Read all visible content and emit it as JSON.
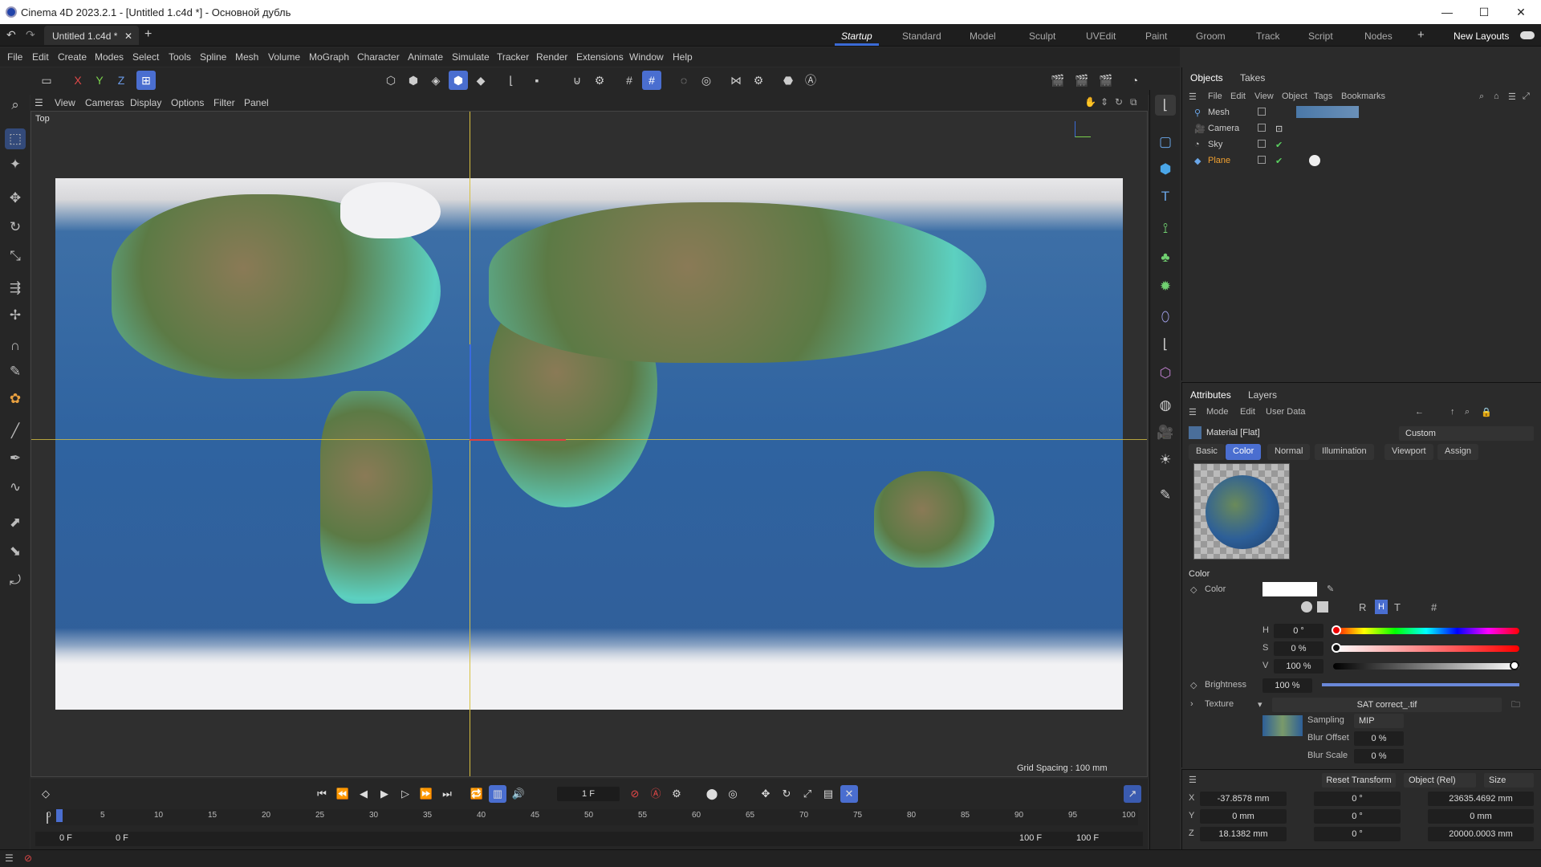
{
  "window": {
    "title": "Cinema 4D 2023.2.1 - [Untitled 1.c4d *] - Основной дубль"
  },
  "tabs": {
    "document": "Untitled 1.c4d *",
    "layouts": [
      "Startup",
      "Standard",
      "Model",
      "Sculpt",
      "UVEdit",
      "Paint",
      "Groom",
      "Track",
      "Script",
      "Nodes"
    ],
    "new_layouts": "New Layouts"
  },
  "menu": [
    "File",
    "Edit",
    "Create",
    "Modes",
    "Select",
    "Tools",
    "Spline",
    "Mesh",
    "Volume",
    "MoGraph",
    "Character",
    "Animate",
    "Simulate",
    "Tracker",
    "Render",
    "Extensions",
    "Window",
    "Help"
  ],
  "axis": {
    "x": "X",
    "y": "Y",
    "z": "Z"
  },
  "viewport": {
    "menu": [
      "View",
      "Cameras",
      "Display",
      "Options",
      "Filter",
      "Panel"
    ],
    "label": "Top",
    "grid_spacing": "Grid Spacing : 100 mm"
  },
  "objects": {
    "tabs": [
      "Objects",
      "Takes"
    ],
    "menu": [
      "File",
      "Edit",
      "View",
      "Object",
      "Tags",
      "Bookmarks"
    ],
    "items": [
      {
        "name": "Mesh",
        "color": "#c8c8c8"
      },
      {
        "name": "Camera",
        "color": "#c8c8c8"
      },
      {
        "name": "Sky",
        "color": "#c8c8c8"
      },
      {
        "name": "Plane",
        "color": "#f0a030"
      }
    ]
  },
  "attributes": {
    "tabs": [
      "Attributes",
      "Layers"
    ],
    "menu": [
      "Mode",
      "Edit",
      "User Data"
    ],
    "material": "Material [Flat]",
    "preset": "Custom",
    "subtabs": [
      "Basic",
      "Color",
      "Normal",
      "Illumination",
      "Viewport",
      "Assign"
    ],
    "section": "Color",
    "color_label": "Color",
    "channel_buttons": [
      "R",
      "H",
      "T",
      "#"
    ],
    "h": {
      "label": "H",
      "value": "0 °"
    },
    "s": {
      "label": "S",
      "value": "0 %"
    },
    "v": {
      "label": "V",
      "value": "100 %"
    },
    "brightness": {
      "label": "Brightness",
      "value": "100 %"
    },
    "texture": {
      "label": "Texture",
      "file": "SAT correct_.tif"
    },
    "sampling": {
      "label": "Sampling",
      "value": "MIP"
    },
    "blur_offset": {
      "label": "Blur Offset",
      "value": "0 %"
    },
    "blur_scale": {
      "label": "Blur Scale",
      "value": "0 %"
    }
  },
  "coords": {
    "reset": "Reset Transform",
    "mode": "Object (Rel)",
    "size": "Size",
    "rows": [
      {
        "axis": "X",
        "pos": "-37.8578 mm",
        "rot": "0 °",
        "size": "23635.4692 mm"
      },
      {
        "axis": "Y",
        "pos": "0 mm",
        "rot": "0 °",
        "size": "0 mm"
      },
      {
        "axis": "Z",
        "pos": "18.1382 mm",
        "rot": "0 °",
        "size": "20000.0003 mm"
      }
    ]
  },
  "timeline": {
    "frame": "1 F",
    "ticks": [
      "0",
      "5",
      "10",
      "15",
      "20",
      "25",
      "30",
      "35",
      "40",
      "45",
      "50",
      "55",
      "60",
      "65",
      "70",
      "75",
      "80",
      "85",
      "90",
      "95",
      "100"
    ],
    "start": "0 F",
    "start2": "0 F",
    "end": "100 F",
    "end2": "100 F"
  }
}
